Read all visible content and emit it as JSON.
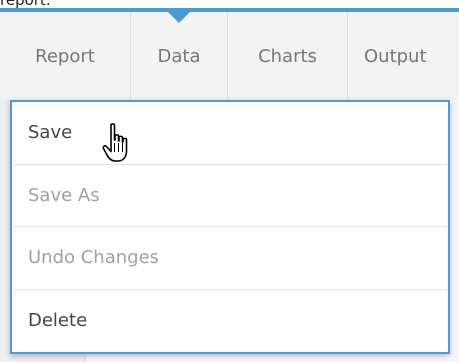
{
  "top_fragment": "report.",
  "menubar": {
    "tabs": [
      {
        "label": "Report"
      },
      {
        "label": "Data"
      },
      {
        "label": "Charts"
      },
      {
        "label": "Output"
      }
    ],
    "active_tab": "Data"
  },
  "dropdown": {
    "items": [
      {
        "label": "Save",
        "state": "enabled"
      },
      {
        "label": "Save As",
        "state": "disabled"
      },
      {
        "label": "Undo Changes",
        "state": "disabled"
      },
      {
        "label": "Delete",
        "state": "enabled"
      }
    ]
  },
  "colors": {
    "accent": "#4a9bd6",
    "menubar_bg": "#f3f3f3",
    "text_active": "#444444",
    "text_disabled": "#a0a0a0"
  },
  "icons": {
    "cursor": "hand-pointer-icon",
    "active_tab_marker": "tab-pointer-icon"
  }
}
